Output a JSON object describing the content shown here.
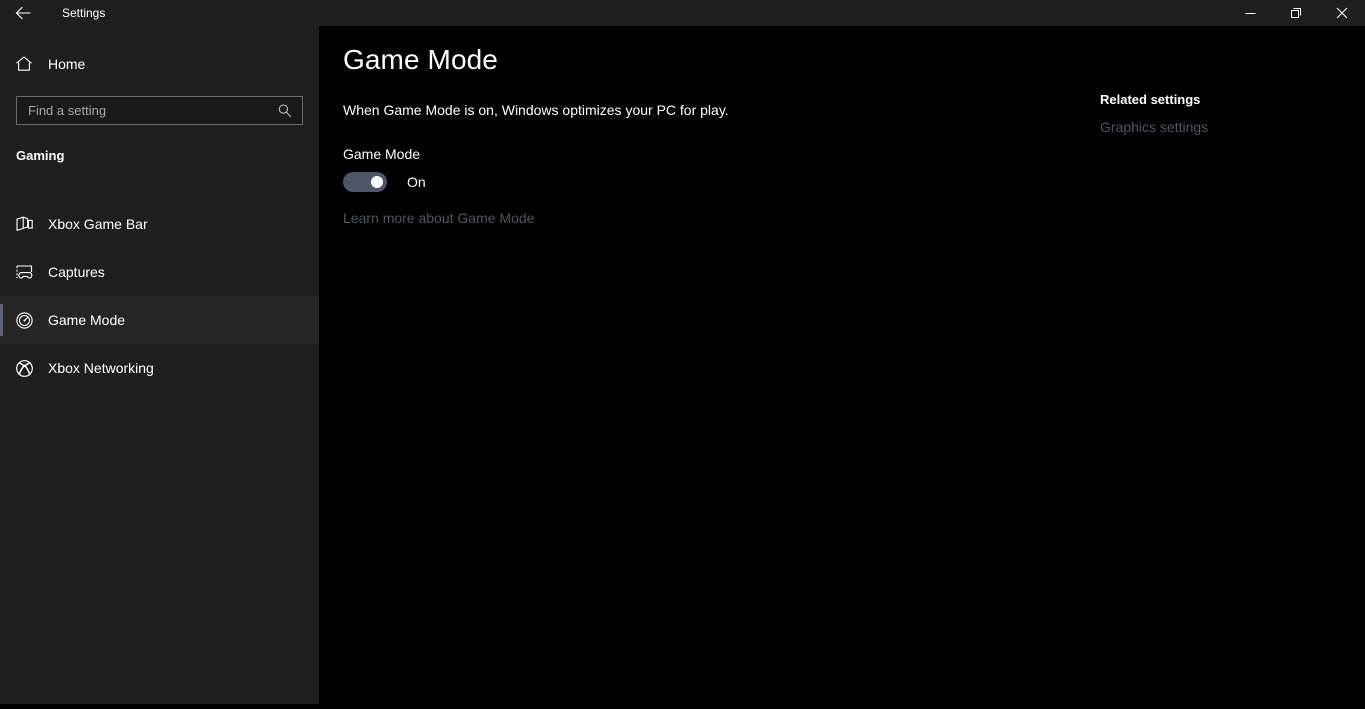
{
  "titlebar": {
    "app_title": "Settings",
    "back_icon": "back-arrow-icon",
    "minimize_label": "Minimize",
    "restore_label": "Restore",
    "close_label": "Close"
  },
  "sidebar": {
    "home_label": "Home",
    "home_icon": "home-icon",
    "search": {
      "placeholder": "Find a setting",
      "value": "",
      "icon": "search-icon"
    },
    "group_title": "Gaming",
    "items": [
      {
        "label": "Xbox Game Bar",
        "icon": "game-bar-icon",
        "selected": false
      },
      {
        "label": "Captures",
        "icon": "captures-icon",
        "selected": false
      },
      {
        "label": "Game Mode",
        "icon": "game-mode-gauge-icon",
        "selected": true
      },
      {
        "label": "Xbox Networking",
        "icon": "xbox-logo-icon",
        "selected": false
      }
    ]
  },
  "main": {
    "page_title": "Game Mode",
    "description": "When Game Mode is on, Windows optimizes your PC for play.",
    "setting_label": "Game Mode",
    "toggle_state": "On",
    "toggle_on": true,
    "learn_more": "Learn more about Game Mode"
  },
  "related": {
    "title": "Related settings",
    "links": [
      {
        "label": "Graphics settings"
      }
    ]
  },
  "colors": {
    "sidebar_bg": "#1f1f1f",
    "content_bg": "#000000",
    "accent_bar": "#55647c",
    "toggle_track": "#4e5766",
    "link": "#4d5663"
  }
}
